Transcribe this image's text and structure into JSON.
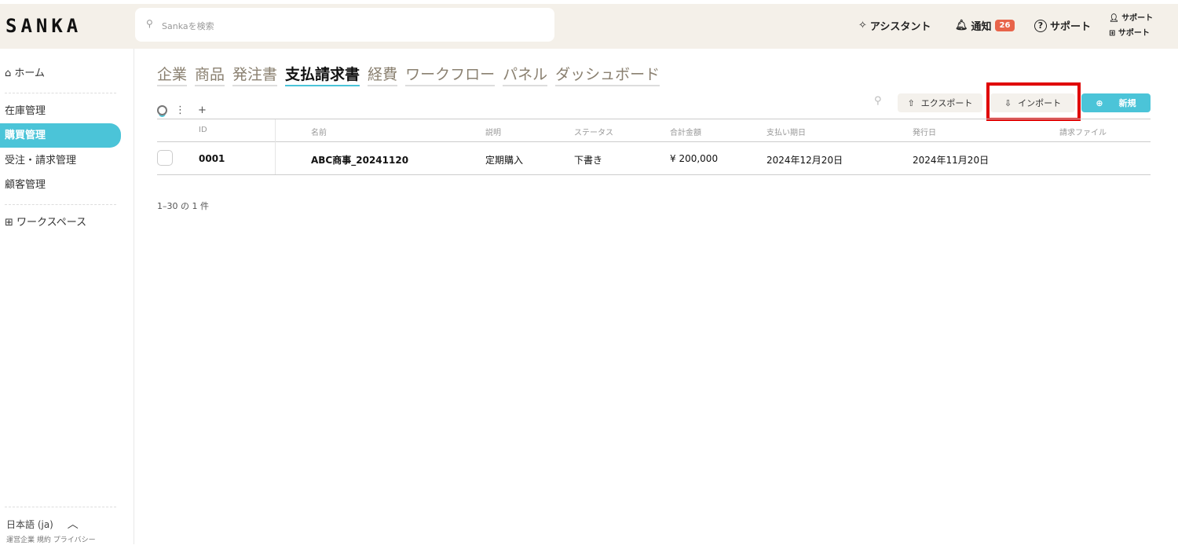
{
  "header": {
    "logo": "SANKA",
    "search_placeholder": "Sankaを検索",
    "assistant": "アシスタント",
    "notifications": "通知",
    "notification_count": "26",
    "support": "サポート",
    "user_name": "サポート",
    "workspace_name": "サポート"
  },
  "sidebar": {
    "home": "ホーム",
    "items": [
      {
        "label": "在庫管理"
      },
      {
        "label": "購買管理"
      },
      {
        "label": "受注・請求管理"
      },
      {
        "label": "顧客管理"
      }
    ],
    "workspace": "ワークスペース",
    "language": "日本語 (ja)",
    "footer_links": [
      "運営企業",
      "規約",
      "プライバシー"
    ]
  },
  "tabs": [
    {
      "label": "企業"
    },
    {
      "label": "商品"
    },
    {
      "label": "発注書"
    },
    {
      "label": "支払請求書"
    },
    {
      "label": "経費"
    },
    {
      "label": "ワークフロー"
    },
    {
      "label": "パネル"
    },
    {
      "label": "ダッシュボード"
    }
  ],
  "toolbar": {
    "export": "エクスポート",
    "import": "インポート",
    "new": "新規"
  },
  "table": {
    "columns": [
      "ID",
      "名前",
      "説明",
      "ステータス",
      "合計金額",
      "支払い期日",
      "発行日",
      "請求ファイル"
    ],
    "rows": [
      [
        "0001",
        "ABC商事_20241120",
        "定期購入",
        "下書き",
        "¥ 200,000",
        "2024年12月20日",
        "2024年11月20日",
        ""
      ]
    ]
  },
  "pagination": "1–30 の 1 件",
  "colors": {
    "accent": "#4bc4d8",
    "badge": "#e8644a",
    "highlight": "#e00000"
  }
}
